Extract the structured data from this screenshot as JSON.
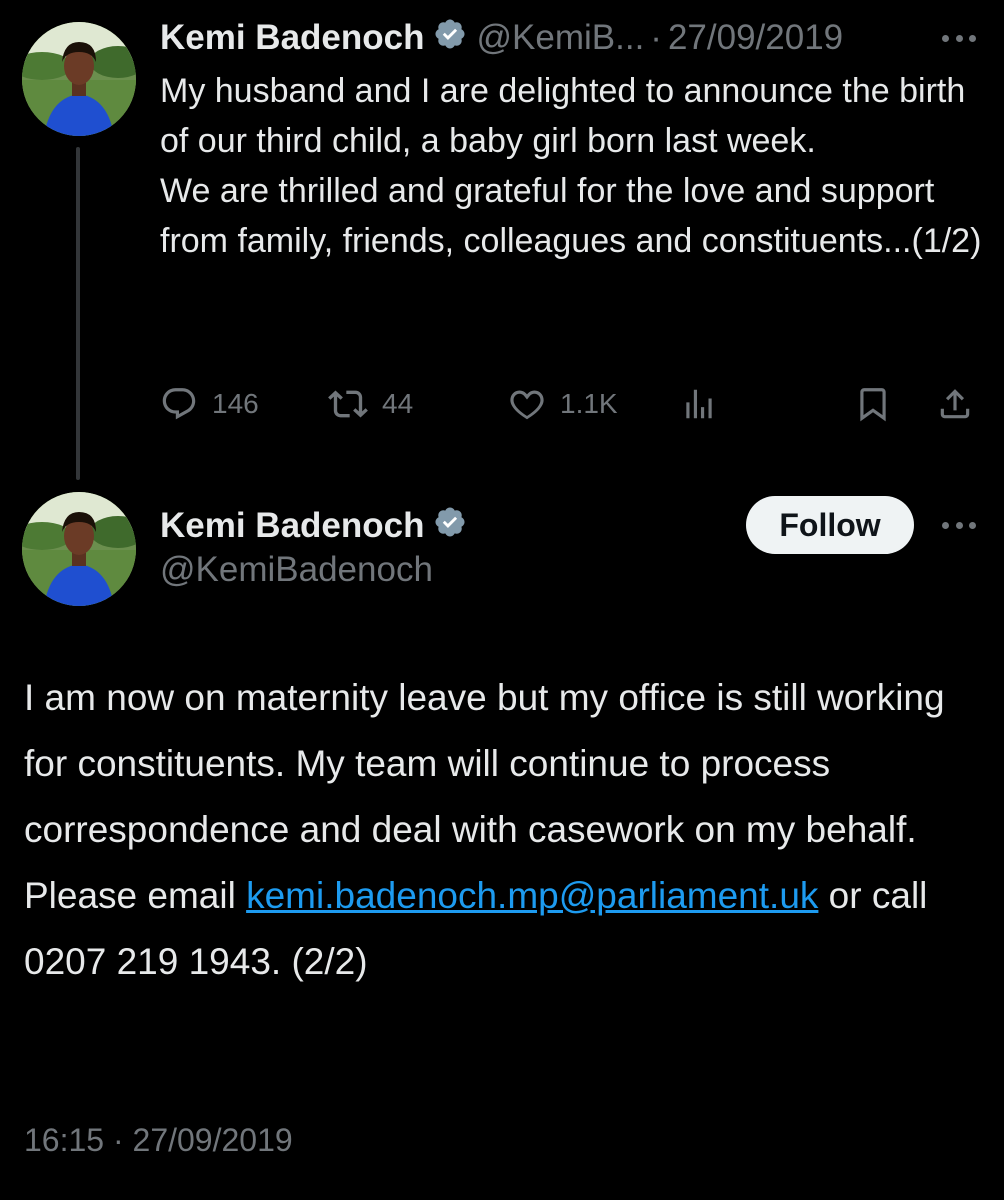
{
  "thread": {
    "tweet1": {
      "display_name": "Kemi Badenoch",
      "handle": "@KemiB...",
      "separator": "·",
      "date": "27/09/2019",
      "body_lines": [
        "My husband and I are delighted to announce the birth of our third child, a baby girl born last week.",
        "We are thrilled and grateful for the love and support from family, friends, colleagues and constituents...(1/2)"
      ],
      "actions": {
        "replies": "146",
        "reposts": "44",
        "likes": "1.1K"
      }
    },
    "tweet2": {
      "display_name": "Kemi Badenoch",
      "handle": "@KemiBadenoch",
      "follow_label": "Follow",
      "body_before_link": "I am now on maternity leave but my office is still working for constituents.  My team will continue to process correspondence and deal with casework on my behalf. Please email ",
      "email_link": "kemi.badenoch.mp@parliament.uk",
      "body_after_link": " or call 0207 219 1943. (2/2)",
      "timestamp": "16:15 · 27/09/2019"
    }
  },
  "icons": {
    "verified": "verified-badge-icon",
    "more": "more-icon",
    "reply": "reply-icon",
    "repost": "repost-icon",
    "like": "like-icon",
    "views": "views-icon",
    "bookmark": "bookmark-icon",
    "share": "share-icon"
  },
  "colors": {
    "background": "#000000",
    "text": "#e7e9ea",
    "muted": "#71767b",
    "link": "#1d9bf0",
    "thread_line": "#333639",
    "follow_button_bg": "#eff3f4"
  }
}
